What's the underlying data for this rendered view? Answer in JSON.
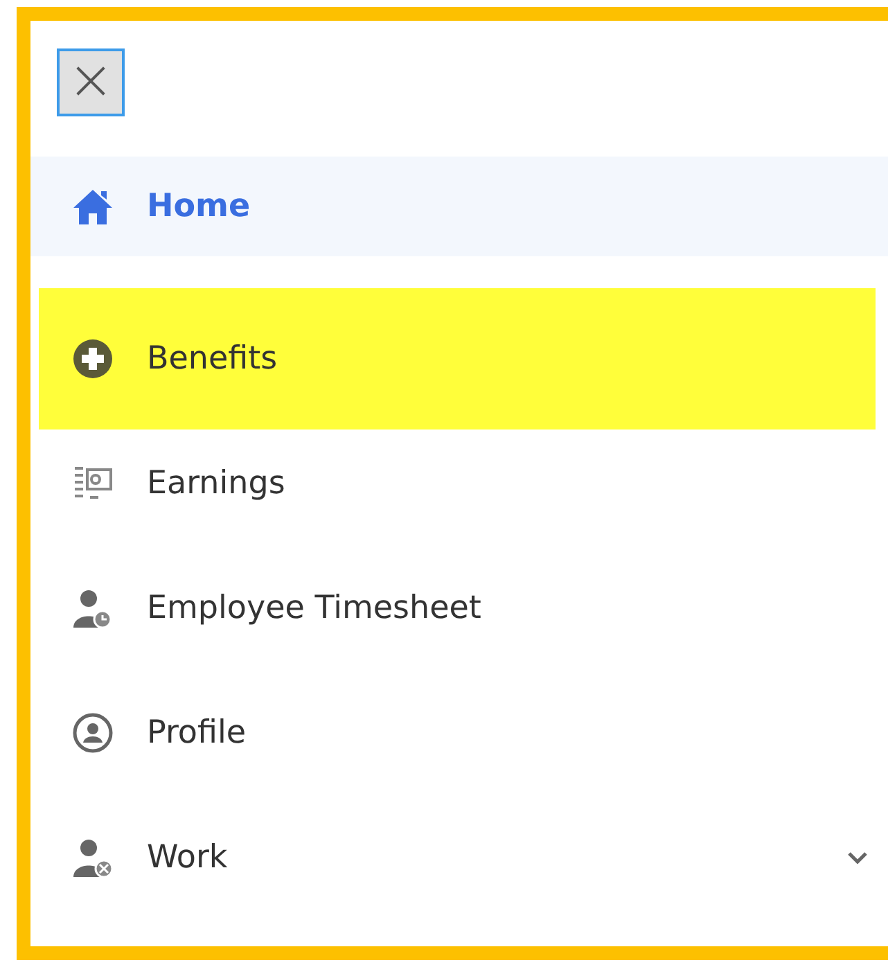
{
  "close_button": {
    "label": "×"
  },
  "menu": [
    {
      "label": "Home",
      "kind": "home",
      "selected": true,
      "highlighted": false
    },
    {
      "label": "Benefits",
      "kind": "plus",
      "selected": false,
      "highlighted": true
    },
    {
      "label": "Earnings",
      "kind": "earnings",
      "selected": false,
      "highlighted": false
    },
    {
      "label": "Employee Timesheet",
      "kind": "timesheet",
      "selected": false,
      "highlighted": false
    },
    {
      "label": "Profile",
      "kind": "profile",
      "selected": false,
      "highlighted": false
    },
    {
      "label": "Work",
      "kind": "work",
      "selected": false,
      "highlighted": false,
      "expanded": false
    }
  ]
}
